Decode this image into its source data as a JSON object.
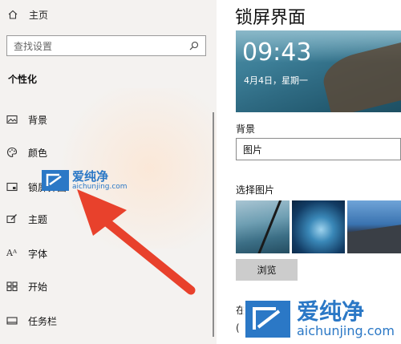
{
  "sidebar": {
    "home_label": "主页",
    "search_placeholder": "查找设置",
    "section_title": "个性化",
    "items": [
      {
        "label": "背景",
        "icon": "image-icon"
      },
      {
        "label": "颜色",
        "icon": "palette-icon"
      },
      {
        "label": "锁屏界面",
        "icon": "lock-screen-icon"
      },
      {
        "label": "主题",
        "icon": "theme-brush-icon"
      },
      {
        "label": "字体",
        "icon": "font-icon"
      },
      {
        "label": "开始",
        "icon": "start-grid-icon"
      },
      {
        "label": "任务栏",
        "icon": "taskbar-icon"
      }
    ]
  },
  "main": {
    "title": "锁屏界面",
    "preview": {
      "time": "09:43",
      "date": "4月4日，星期一"
    },
    "background_label": "背景",
    "background_value": "图片",
    "choose_picture_label": "选择图片",
    "browse_label": "浏览",
    "partial_text_1": "在",
    "partial_text_2": "("
  },
  "watermark": {
    "cn": "爱纯净",
    "en": "aichunjing.com"
  },
  "colors": {
    "accent": "#2b78c6",
    "annotation_arrow": "#e8412c"
  }
}
